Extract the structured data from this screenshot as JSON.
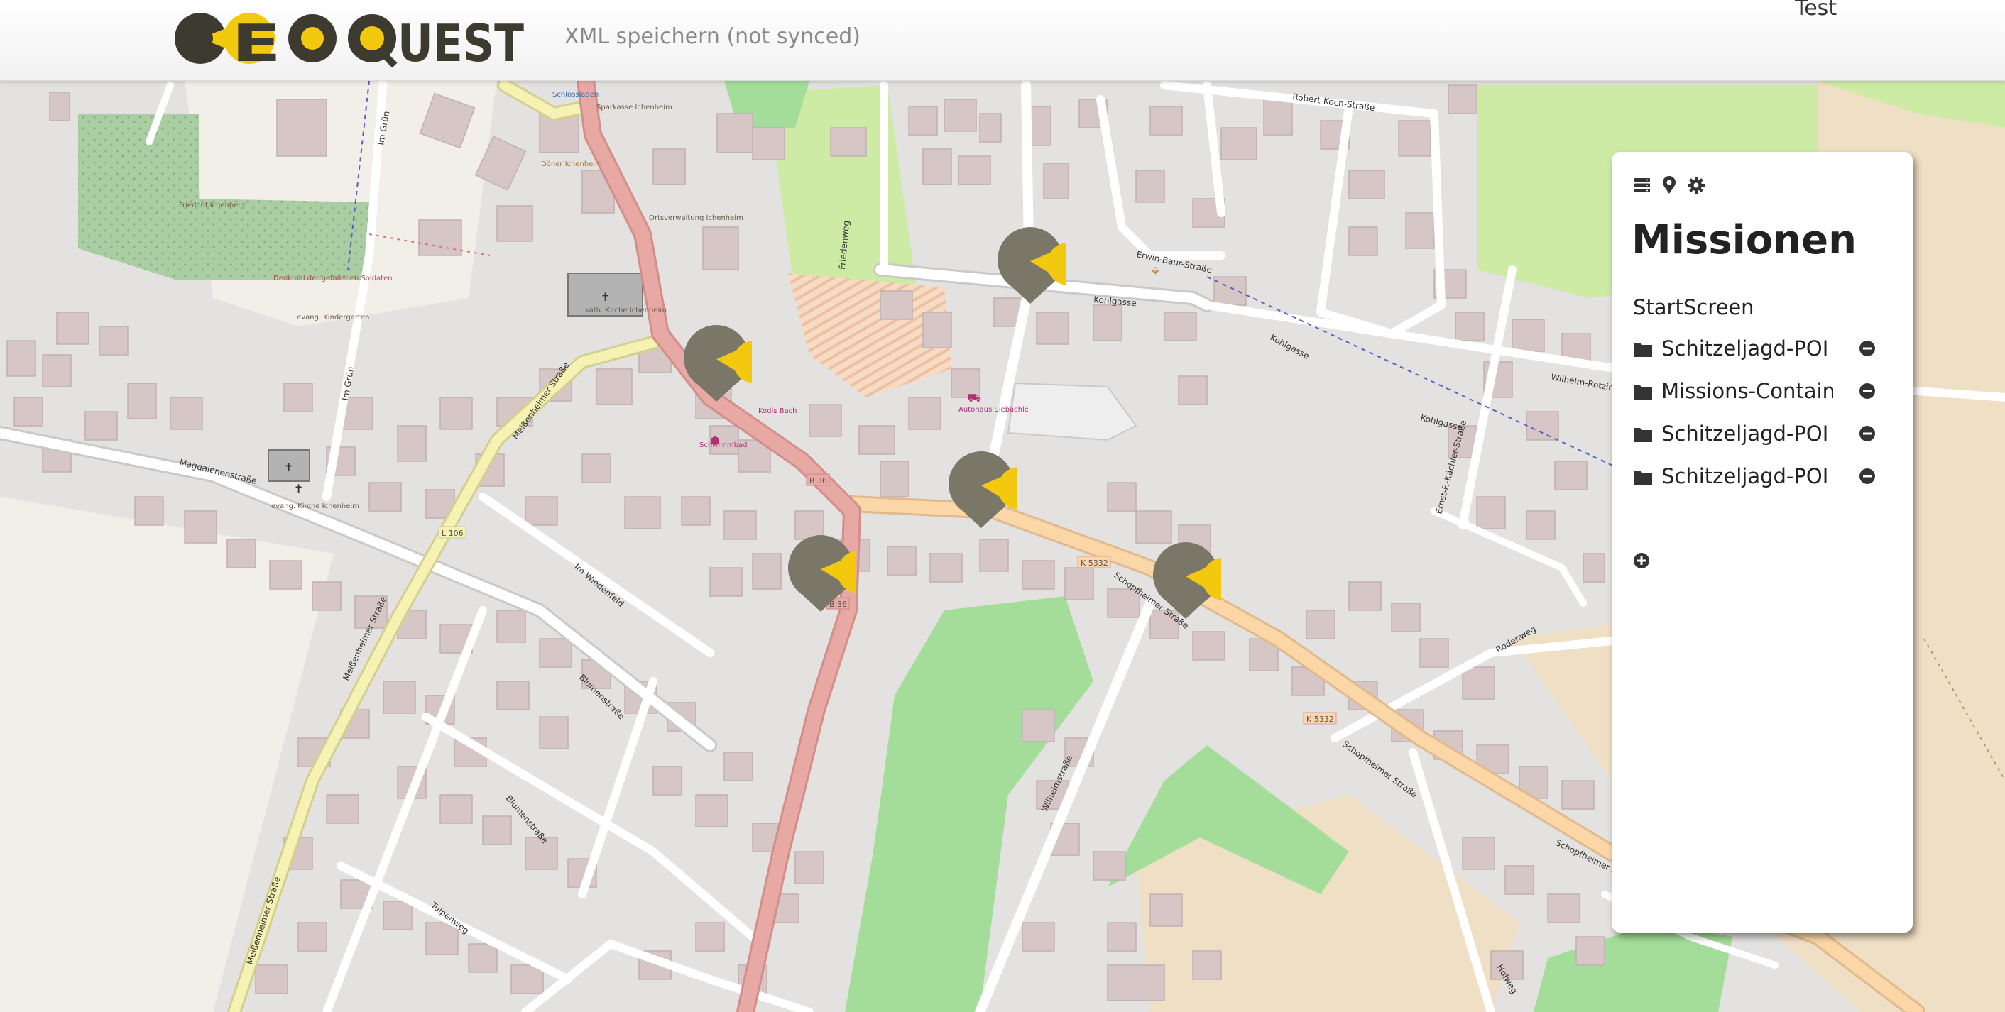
{
  "header": {
    "logo_text": "GEOQUEST",
    "sync_status": "XML speichern (not synced)",
    "user_label": "Test"
  },
  "panel": {
    "icons": [
      "server-stack-icon",
      "map-pin-icon",
      "gear-icon"
    ],
    "title": "Missionen",
    "start_screen": "StartScreen",
    "missions": [
      {
        "label": "Schitzeljagd-POI"
      },
      {
        "label": "Missions-Container"
      },
      {
        "label": "Schitzeljagd-POI"
      },
      {
        "label": "Schitzeljagd-POI"
      }
    ],
    "add_icon": "plus-circle-icon"
  },
  "map": {
    "streets": {
      "kohlgasse": "Kohlgasse",
      "robert_koch": "Robert-Koch-Straße",
      "erwin_baur": "Erwin-Baur-Straße",
      "friedenweg": "Friedenweg",
      "meissenheimer_1": "Meißenheimer Straße",
      "meissenheimer_2": "Meißenheimer Straße",
      "meissenheimer_3": "Meißenheimer Straße",
      "magdalenen": "Magdalenenstraße",
      "im_gruen_1": "Im Grün",
      "im_gruen_2": "Im Grün",
      "im_wiedenfeld": "Im Wiedenfeld",
      "blumen_1": "Blumenstraße",
      "blumen_2": "Blumenstraße",
      "tulpenweg": "Tulpenweg",
      "schopfheimer_1": "Schopfheimer Straße",
      "schopfheimer_2": "Schopfheimer Straße",
      "schopfheimer_3": "Schopfheimer Straße",
      "wilhelm_1": "Wilhelmstraße",
      "wilhelm_2": "Wilhelm-Rotzinger",
      "ernst_kaechler": "Ernst-F.-Kächler-Straße",
      "rodenweg": "Rodenweg",
      "hofweg": "Hofweg",
      "kohlgasse_2": "Kohlgasse",
      "kohlgasse_3": "Kohlgasse"
    },
    "road_refs": {
      "b36_1": "B 36",
      "b36_2": "B 36",
      "l106": "L 106",
      "k5332_1": "K 5332",
      "k5332_2": "K 5332"
    },
    "pois": {
      "friedhof": "Friedhof Ichenheim",
      "denkmal": "Denkmal der gefallenen Soldaten",
      "kindergarten": "evang. Kindergarten",
      "kath_kirche": "kath. Kirche Ichenheim",
      "evang_kirche": "evang. Kirche Ichenheim",
      "ortsverwaltung": "Ortsverwaltung Ichenheim",
      "sparkasse": "Sparkasse Ichenheim",
      "doener": "Döner Ichenheim",
      "schwimmbad": "Schwimmbad",
      "kodis_bach": "Kodis Bach",
      "autohaus": "Autohaus Siebächle",
      "schlossladen": "Schlossladen"
    },
    "marker_count": 5
  },
  "colors": {
    "accent_yellow": "#f2c90f",
    "marker_gray": "#7a7769",
    "logo_dark": "#3d3a30",
    "map_background": "#f2efe9",
    "primary_road": "#e8a8a3",
    "secondary_road": "#fbd7a8",
    "tertiary_road": "#f6f2b4",
    "building": "#d6c6c6",
    "park": "#a4dd99",
    "farmland": "#efdfc5"
  }
}
